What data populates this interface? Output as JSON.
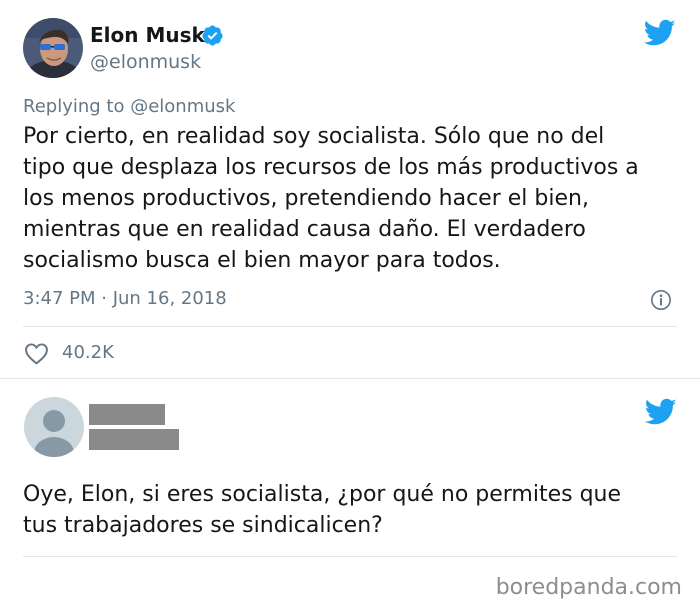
{
  "tweet": {
    "author_name": "Elon Musk",
    "author_handle": "@elonmusk",
    "verified": true,
    "reply_context": "Replying to @elonmusk",
    "body_lines": [
      "Por cierto, en realidad soy socialista. Sólo que no del",
      "tipo que desplaza los recursos de los más productivos a",
      "los menos productivos, pretendiendo hacer el bien,",
      "mientras que en realidad causa daño. El verdadero",
      "socialismo busca el bien mayor para todos."
    ],
    "timestamp": "3:47 PM · Jun 16, 2018",
    "likes": "40.2K",
    "icons": {
      "platform": "twitter-bird-icon",
      "verified": "verified-badge-icon",
      "info": "info-icon",
      "like": "heart-icon"
    }
  },
  "reply": {
    "author_redacted": true,
    "body_lines": [
      "Oye, Elon, si eres socialista, ¿por qué no permites que",
      "tus trabajadores se sindicalicen?"
    ],
    "icons": {
      "avatar": "default-avatar-icon",
      "platform": "twitter-bird-icon"
    }
  },
  "watermark": "boredpanda.com",
  "colors": {
    "twitter_blue": "#1da1f2",
    "text": "#14171a",
    "secondary_text": "#657786",
    "divider": "#e1e8ed",
    "redaction": "#8a8a8a"
  }
}
